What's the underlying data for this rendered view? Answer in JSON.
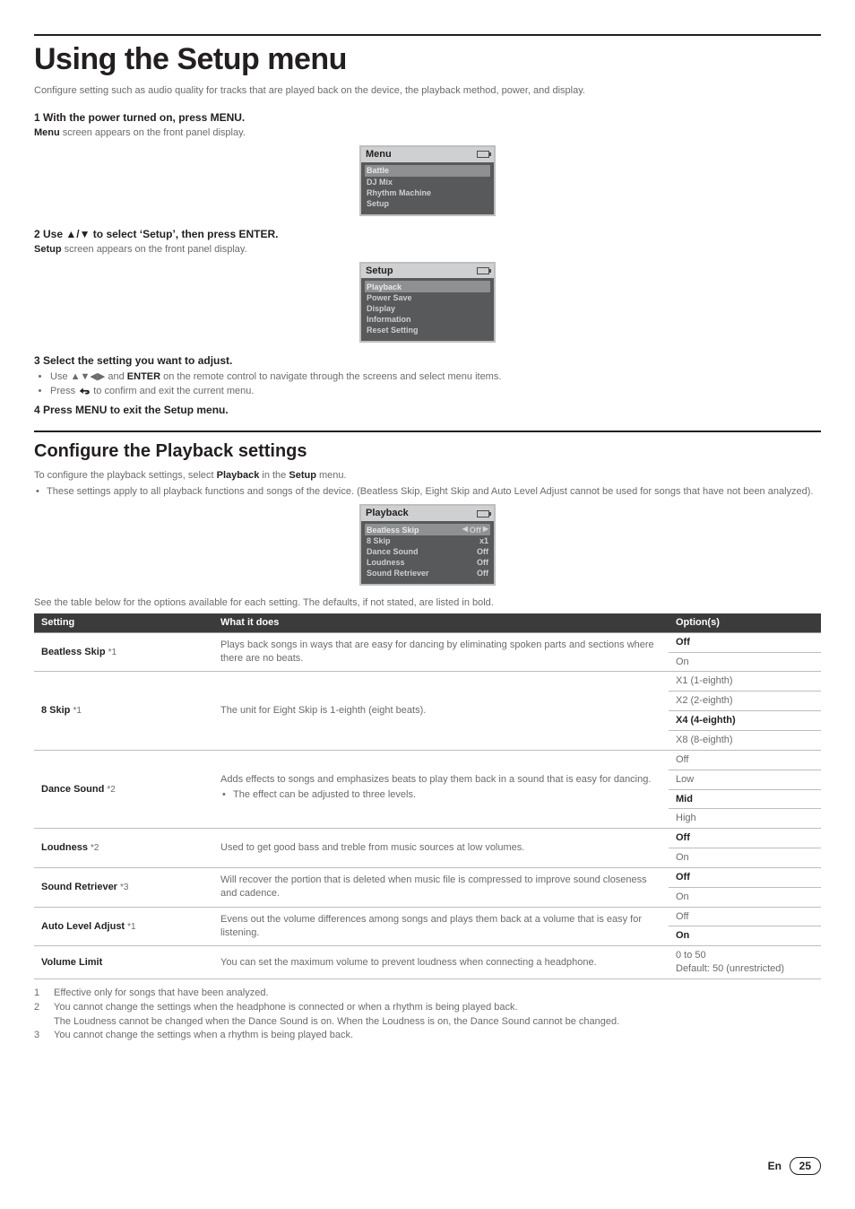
{
  "page": {
    "title": "Using the Setup menu",
    "intro": "Configure setting such as audio quality for tracks that are played back on the device, the playback method, power, and display.",
    "page_number": "25",
    "lang": "En"
  },
  "steps": {
    "s1_head": "1   With the power turned on, press MENU.",
    "s1_sub_prefix": "Menu",
    "s1_sub_rest": " screen appears on the front panel display.",
    "s2_head": "2   Use ▲/▼ to select ‘Setup’, then press ENTER.",
    "s2_sub_prefix": "Setup",
    "s2_sub_rest": " screen appears on the front panel display.",
    "s3_head": "3   Select the setting you want to adjust.",
    "s3_b1_pre": "Use ",
    "s3_b1_arrows": "▲▼◀▶",
    "s3_b1_mid": " and ",
    "s3_b1_enter": "ENTER",
    "s3_b1_post": " on the remote control to navigate through the screens and select menu items.",
    "s3_b2_pre": "Press ",
    "s3_b2_post": " to confirm and exit the current menu.",
    "s4_head": "4   Press MENU to exit the Setup menu."
  },
  "lcd_menu": {
    "title": "Menu",
    "items": [
      "Battle",
      "DJ Mix",
      "Rhythm Machine",
      "Setup"
    ]
  },
  "lcd_setup": {
    "title": "Setup",
    "items": [
      "Playback",
      "Power Save",
      "Display",
      "Information",
      "Reset Setting"
    ]
  },
  "section2": {
    "title": "Configure the Playback settings",
    "lead_pre": "To configure the playback settings, select ",
    "lead_b1": "Playback",
    "lead_mid": " in the ",
    "lead_b2": "Setup",
    "lead_post": " menu.",
    "note": "These settings apply to all playback functions and songs of the device. (Beatless Skip, Eight Skip and Auto Level Adjust cannot be used for songs that have not been analyzed)."
  },
  "lcd_playback": {
    "title": "Playback",
    "rows": [
      {
        "name": "Beatless Skip",
        "val": "Off",
        "hl": true
      },
      {
        "name": "8 Skip",
        "val": "x1"
      },
      {
        "name": "Dance Sound",
        "val": "Off"
      },
      {
        "name": "Loudness",
        "val": "Off"
      },
      {
        "name": "Sound Retriever",
        "val": "Off"
      }
    ]
  },
  "table": {
    "caption": "See the table below for the options available for each setting. The defaults, if not stated, are listed in bold.",
    "head": {
      "c1": "Setting",
      "c2": "What it does",
      "c3": "Option(s)"
    },
    "rows": [
      {
        "name": "Beatless Skip",
        "fn": "*1",
        "desc": "Plays back songs in ways that are easy for dancing by eliminating spoken parts and sections where there are no beats.",
        "opts": [
          {
            "t": "Off",
            "b": true
          },
          {
            "t": "On"
          }
        ]
      },
      {
        "name": "8 Skip",
        "fn": "*1",
        "desc": "The unit for Eight Skip is 1-eighth (eight beats).",
        "opts": [
          {
            "t": "X1 (1-eighth)"
          },
          {
            "t": "X2 (2-eighth)"
          },
          {
            "t": "X4 (4-eighth)",
            "b": true
          },
          {
            "t": "X8 (8-eighth)"
          }
        ]
      },
      {
        "name": "Dance Sound",
        "fn": "*2",
        "desc": "Adds effects to songs and emphasizes beats to play them back in a sound that is easy for dancing.",
        "desc_bullet": "The effect can be adjusted to three levels.",
        "opts": [
          {
            "t": "Off"
          },
          {
            "t": "Low"
          },
          {
            "t": "Mid",
            "b": true
          },
          {
            "t": "High"
          }
        ]
      },
      {
        "name": "Loudness",
        "fn": "*2",
        "desc": "Used to get good bass and treble from music sources at low volumes.",
        "opts": [
          {
            "t": "Off",
            "b": true
          },
          {
            "t": "On"
          }
        ]
      },
      {
        "name": "Sound Retriever",
        "fn": "*3",
        "desc": "Will recover the portion that is deleted when music file is compressed to improve sound closeness and cadence.",
        "opts": [
          {
            "t": "Off",
            "b": true
          },
          {
            "t": "On"
          }
        ]
      },
      {
        "name": "Auto Level Adjust",
        "fn": "*1",
        "desc": "Evens out the volume differences among songs and plays them back at a volume that is easy for listening.",
        "opts": [
          {
            "t": "Off"
          },
          {
            "t": "On",
            "b": true
          }
        ]
      },
      {
        "name": "Volume Limit",
        "fn": "",
        "desc": "You can set the maximum volume to prevent loudness when connecting a headphone.",
        "opts": [
          {
            "t": "0 to 50\nDefault: 50 (unrestricted)"
          }
        ]
      }
    ]
  },
  "footnotes": [
    {
      "n": "1",
      "t": "Effective only for songs that have been analyzed."
    },
    {
      "n": "2",
      "t": "You cannot change the settings when the headphone is connected or when a rhythm is being played back."
    },
    {
      "n": "",
      "t": "The Loudness cannot be changed when the Dance Sound is on. When the Loudness is on, the Dance Sound cannot be changed."
    },
    {
      "n": "3",
      "t": "You cannot change the settings when a rhythm is being played back."
    }
  ]
}
